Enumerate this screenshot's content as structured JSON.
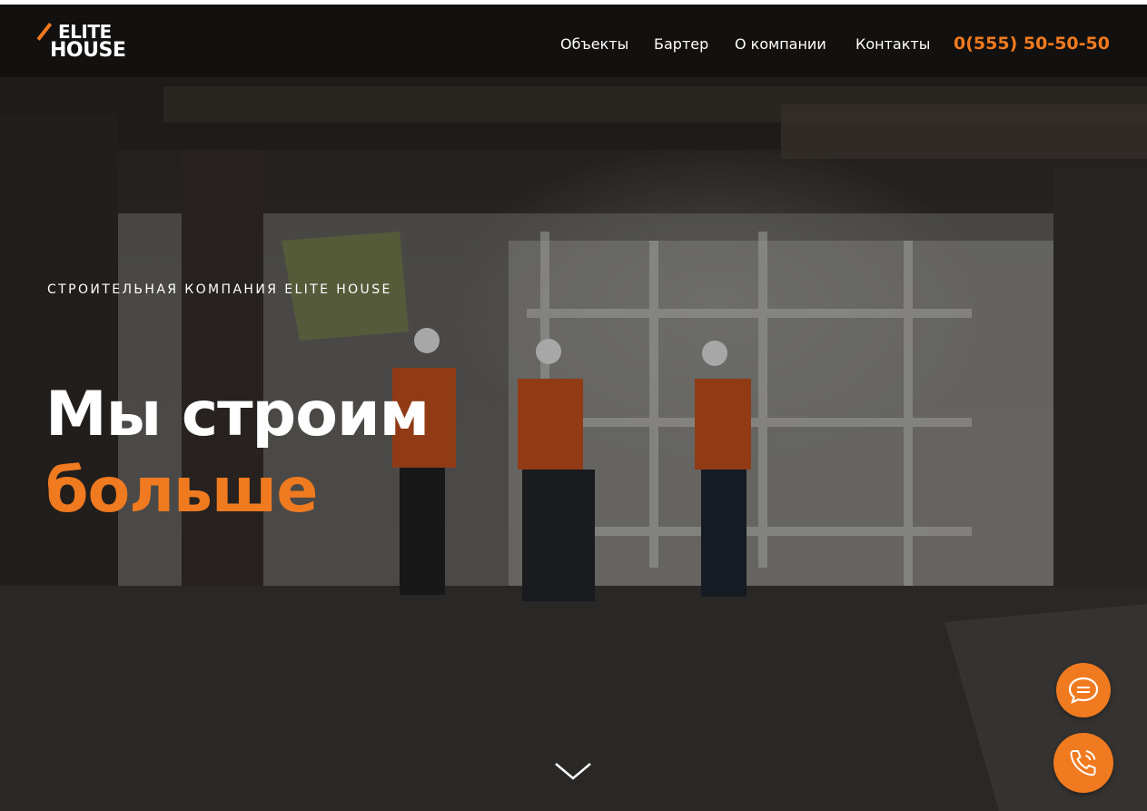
{
  "brand": {
    "logo_top": "ELITE",
    "logo_bottom": "HOUSE",
    "accent_color": "#f07a1f"
  },
  "nav": {
    "items": [
      "Объекты",
      "Бартер",
      "О компании",
      "Контакты"
    ],
    "phone": "0(555) 50-50-50"
  },
  "hero": {
    "subtitle": "СТРОИТЕЛЬНАЯ КОМПАНИЯ ELITE HOUSE",
    "headline_line1": "Мы строим",
    "headline_line2": "больше"
  },
  "floating_buttons": {
    "chat_icon": "chat-bubble-icon",
    "call_icon": "phone-ringing-icon",
    "scroll_icon": "chevron-down-icon"
  }
}
